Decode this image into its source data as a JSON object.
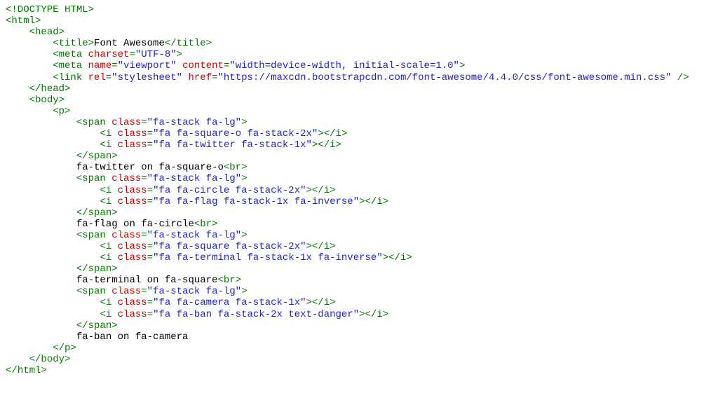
{
  "c": {
    "l01": "<!DOCTYPE HTML>",
    "l02a": "<",
    "l02b": "html",
    "l02c": ">",
    "l03a": "    <",
    "l03b": "head",
    "l03c": ">",
    "l04a": "        <",
    "l04b": "title",
    "l04c": ">",
    "l04d": "Font Awesome",
    "l04e": "</",
    "l04f": "title",
    "l04g": ">",
    "l05a": "        <",
    "l05b": "meta",
    "l05c": " ",
    "l05d": "charset",
    "l05e": "=",
    "l05f": "\"UTF-8\"",
    "l05g": ">",
    "l06a": "        <",
    "l06b": "meta",
    "l06c": " ",
    "l06d": "name",
    "l06e": "=",
    "l06f": "\"viewport\"",
    "l06g": " ",
    "l06h": "content",
    "l06i": "=",
    "l06j": "\"width=device-width, initial-scale=1.0\"",
    "l06k": ">",
    "l07a": "        <",
    "l07b": "link",
    "l07c": " ",
    "l07d": "rel",
    "l07e": "=",
    "l07f": "\"stylesheet\"",
    "l07g": " ",
    "l07h": "href",
    "l07i": "=",
    "l07j": "\"https://maxcdn.bootstrapcdn.com/font-awesome/4.4.0/css/font-awesome.min.css\"",
    "l07k": " />",
    "l08a": "    </",
    "l08b": "head",
    "l08c": ">",
    "l09a": "    <",
    "l09b": "body",
    "l09c": ">",
    "l10a": "        <",
    "l10b": "p",
    "l10c": ">",
    "l11a": "            <",
    "l11b": "span",
    "l11c": " ",
    "l11d": "class",
    "l11e": "=",
    "l11f": "\"fa-stack fa-lg\"",
    "l11g": ">",
    "l12a": "                <",
    "l12b": "i",
    "l12c": " ",
    "l12d": "class",
    "l12e": "=",
    "l12f": "\"fa fa-square-o fa-stack-2x\"",
    "l12g": "></",
    "l12h": "i",
    "l12i": ">",
    "l13a": "                <",
    "l13b": "i",
    "l13c": " ",
    "l13d": "class",
    "l13e": "=",
    "l13f": "\"fa fa-twitter fa-stack-1x\"",
    "l13g": "></",
    "l13h": "i",
    "l13i": ">",
    "l14a": "            </",
    "l14b": "span",
    "l14c": ">",
    "l15a": "            ",
    "l15b": "fa-twitter on fa-square-o",
    "l15c": "<",
    "l15d": "br",
    "l15e": ">",
    "l16a": "            <",
    "l16b": "span",
    "l16c": " ",
    "l16d": "class",
    "l16e": "=",
    "l16f": "\"fa-stack fa-lg\"",
    "l16g": ">",
    "l17a": "                <",
    "l17b": "i",
    "l17c": " ",
    "l17d": "class",
    "l17e": "=",
    "l17f": "\"fa fa-circle fa-stack-2x\"",
    "l17g": "></",
    "l17h": "i",
    "l17i": ">",
    "l18a": "                <",
    "l18b": "i",
    "l18c": " ",
    "l18d": "class",
    "l18e": "=",
    "l18f": "\"fa fa-flag fa-stack-1x fa-inverse\"",
    "l18g": "></",
    "l18h": "i",
    "l18i": ">",
    "l19a": "            </",
    "l19b": "span",
    "l19c": ">",
    "l20a": "            ",
    "l20b": "fa-flag on fa-circle",
    "l20c": "<",
    "l20d": "br",
    "l20e": ">",
    "l21a": "            <",
    "l21b": "span",
    "l21c": " ",
    "l21d": "class",
    "l21e": "=",
    "l21f": "\"fa-stack fa-lg\"",
    "l21g": ">",
    "l22a": "                <",
    "l22b": "i",
    "l22c": " ",
    "l22d": "class",
    "l22e": "=",
    "l22f": "\"fa fa-square fa-stack-2x\"",
    "l22g": "></",
    "l22h": "i",
    "l22i": ">",
    "l23a": "                <",
    "l23b": "i",
    "l23c": " ",
    "l23d": "class",
    "l23e": "=",
    "l23f": "\"fa fa-terminal fa-stack-1x fa-inverse\"",
    "l23g": "></",
    "l23h": "i",
    "l23i": ">",
    "l24a": "            </",
    "l24b": "span",
    "l24c": ">",
    "l25a": "            ",
    "l25b": "fa-terminal on fa-square",
    "l25c": "<",
    "l25d": "br",
    "l25e": ">",
    "l26a": "            <",
    "l26b": "span",
    "l26c": " ",
    "l26d": "class",
    "l26e": "=",
    "l26f": "\"fa-stack fa-lg\"",
    "l26g": ">",
    "l27a": "                <",
    "l27b": "i",
    "l27c": " ",
    "l27d": "class",
    "l27e": "=",
    "l27f": "\"fa fa-camera fa-stack-1x\"",
    "l27g": "></",
    "l27h": "i",
    "l27i": ">",
    "l28a": "                <",
    "l28b": "i",
    "l28c": " ",
    "l28d": "class",
    "l28e": "=",
    "l28f": "\"fa fa-ban fa-stack-2x text-danger\"",
    "l28g": "></",
    "l28h": "i",
    "l28i": ">",
    "l29a": "            </",
    "l29b": "span",
    "l29c": ">",
    "l30a": "            ",
    "l30b": "fa-ban on fa-camera",
    "l31a": "        </",
    "l31b": "p",
    "l31c": ">",
    "l32a": "    </",
    "l32b": "body",
    "l32c": ">",
    "l33a": "</",
    "l33b": "html",
    "l33c": ">"
  }
}
